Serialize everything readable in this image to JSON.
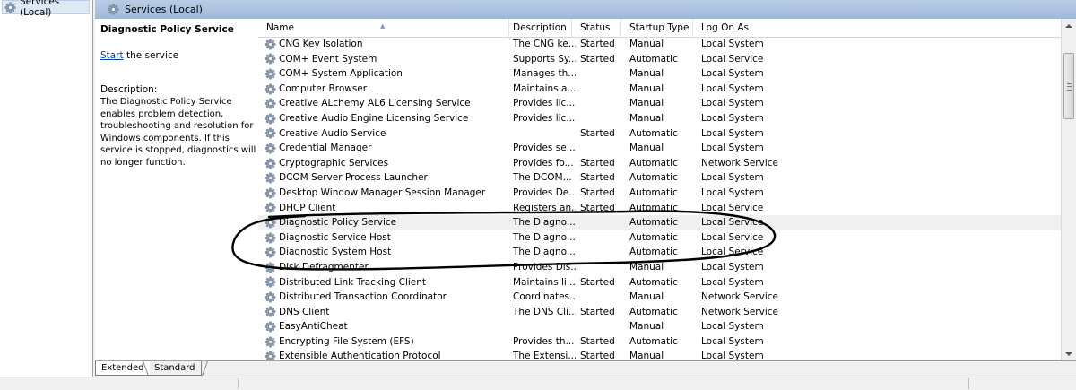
{
  "tree": {
    "item_label": "Services (Local)"
  },
  "header": {
    "title": "Services (Local)"
  },
  "details": {
    "service_name": "Diagnostic Policy Service",
    "start_link": "Start",
    "start_suffix": " the service",
    "description_label": "Description:",
    "description_text": "The Diagnostic Policy Service enables problem detection, troubleshooting and resolution for Windows components.  If this service is stopped, diagnostics will no longer function."
  },
  "columns": {
    "name": "Name",
    "description": "Description",
    "status": "Status",
    "startup_type": "Startup Type",
    "log_on_as": "Log On As"
  },
  "rows": [
    {
      "name": "CNG Key Isolation",
      "description": "The CNG ke...",
      "status": "Started",
      "startup": "Manual",
      "logon": "Local System"
    },
    {
      "name": "COM+ Event System",
      "description": "Supports Sy...",
      "status": "Started",
      "startup": "Automatic",
      "logon": "Local Service"
    },
    {
      "name": "COM+ System Application",
      "description": "Manages th...",
      "status": "",
      "startup": "Manual",
      "logon": "Local System"
    },
    {
      "name": "Computer Browser",
      "description": "Maintains a...",
      "status": "",
      "startup": "Manual",
      "logon": "Local System"
    },
    {
      "name": "Creative ALchemy AL6 Licensing Service",
      "description": "Provides lic...",
      "status": "",
      "startup": "Manual",
      "logon": "Local System"
    },
    {
      "name": "Creative Audio Engine Licensing Service",
      "description": "Provides lic...",
      "status": "",
      "startup": "Manual",
      "logon": "Local System"
    },
    {
      "name": "Creative Audio Service",
      "description": "",
      "status": "Started",
      "startup": "Automatic",
      "logon": "Local System"
    },
    {
      "name": "Credential Manager",
      "description": "Provides se...",
      "status": "",
      "startup": "Manual",
      "logon": "Local System"
    },
    {
      "name": "Cryptographic Services",
      "description": "Provides fo...",
      "status": "Started",
      "startup": "Automatic",
      "logon": "Network Service"
    },
    {
      "name": "DCOM Server Process Launcher",
      "description": "The DCOM...",
      "status": "Started",
      "startup": "Automatic",
      "logon": "Local System"
    },
    {
      "name": "Desktop Window Manager Session Manager",
      "description": "Provides De...",
      "status": "Started",
      "startup": "Automatic",
      "logon": "Local System"
    },
    {
      "name": "DHCP Client",
      "description": "Registers an...",
      "status": "Started",
      "startup": "Automatic",
      "logon": "Local Service"
    },
    {
      "name": "Diagnostic Policy Service",
      "description": "The Diagno...",
      "status": "",
      "startup": "Automatic",
      "logon": "Local Service"
    },
    {
      "name": "Diagnostic Service Host",
      "description": "The Diagno...",
      "status": "",
      "startup": "Automatic",
      "logon": "Local Service"
    },
    {
      "name": "Diagnostic System Host",
      "description": "The Diagno...",
      "status": "",
      "startup": "Automatic",
      "logon": "Local Service"
    },
    {
      "name": "Disk Defragmenter",
      "description": "Provides Dis...",
      "status": "",
      "startup": "Manual",
      "logon": "Local System"
    },
    {
      "name": "Distributed Link Tracking Client",
      "description": "Maintains li...",
      "status": "Started",
      "startup": "Automatic",
      "logon": "Local System"
    },
    {
      "name": "Distributed Transaction Coordinator",
      "description": "Coordinates...",
      "status": "",
      "startup": "Manual",
      "logon": "Network Service"
    },
    {
      "name": "DNS Client",
      "description": "The DNS Cli...",
      "status": "Started",
      "startup": "Automatic",
      "logon": "Network Service"
    },
    {
      "name": "EasyAntiCheat",
      "description": "",
      "status": "",
      "startup": "Manual",
      "logon": "Local System"
    },
    {
      "name": "Encrypting File System (EFS)",
      "description": "Provides th...",
      "status": "Started",
      "startup": "Automatic",
      "logon": "Local System"
    },
    {
      "name": "Extensible Authentication Protocol",
      "description": "The Extensi...",
      "status": "Started",
      "startup": "Manual",
      "logon": "Local System"
    }
  ],
  "selected_row": "Diagnostic Policy Service",
  "tabs": {
    "extended": "Extended",
    "standard": "Standard"
  },
  "icons": {
    "service": "gear-icon",
    "sort": "sort-ascending-icon"
  },
  "colors": {
    "header_bg": "#aec4e0",
    "annotation": "#000000",
    "link": "#0645ad"
  }
}
